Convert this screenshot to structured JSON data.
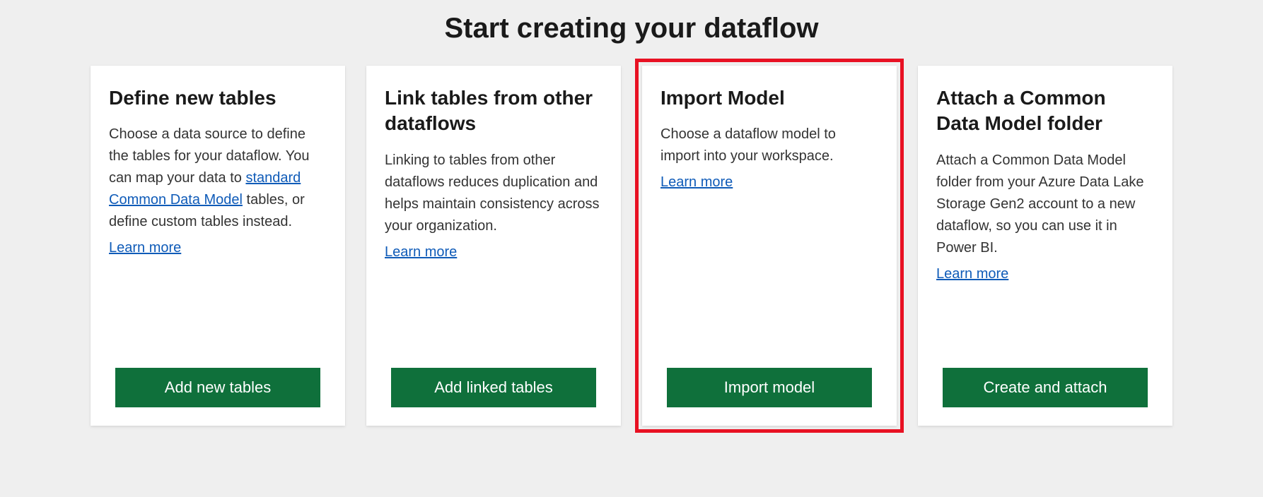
{
  "page": {
    "title": "Start creating your dataflow"
  },
  "cards": [
    {
      "title": "Define new tables",
      "desc_pre": "Choose a data source to define the tables for your dataflow. You can map your data to ",
      "link_text": "standard Common Data Model",
      "desc_post": " tables, or define custom tables instead.",
      "learn_more": "Learn more",
      "button": "Add new tables"
    },
    {
      "title": "Link tables from other dataflows",
      "desc_pre": "Linking to tables from other dataflows reduces duplication and helps maintain consistency across your organization.",
      "link_text": "",
      "desc_post": "",
      "learn_more": "Learn more",
      "button": "Add linked tables"
    },
    {
      "title": "Import Model",
      "desc_pre": "Choose a dataflow model to import into your workspace.",
      "link_text": "",
      "desc_post": "",
      "learn_more": "Learn more",
      "button": "Import model"
    },
    {
      "title": "Attach a Common Data Model folder",
      "desc_pre": "Attach a Common Data Model folder from your Azure Data Lake Storage Gen2 account to a new dataflow, so you can use it in Power BI.",
      "link_text": "",
      "desc_post": "",
      "learn_more": "Learn more",
      "button": "Create and attach"
    }
  ]
}
